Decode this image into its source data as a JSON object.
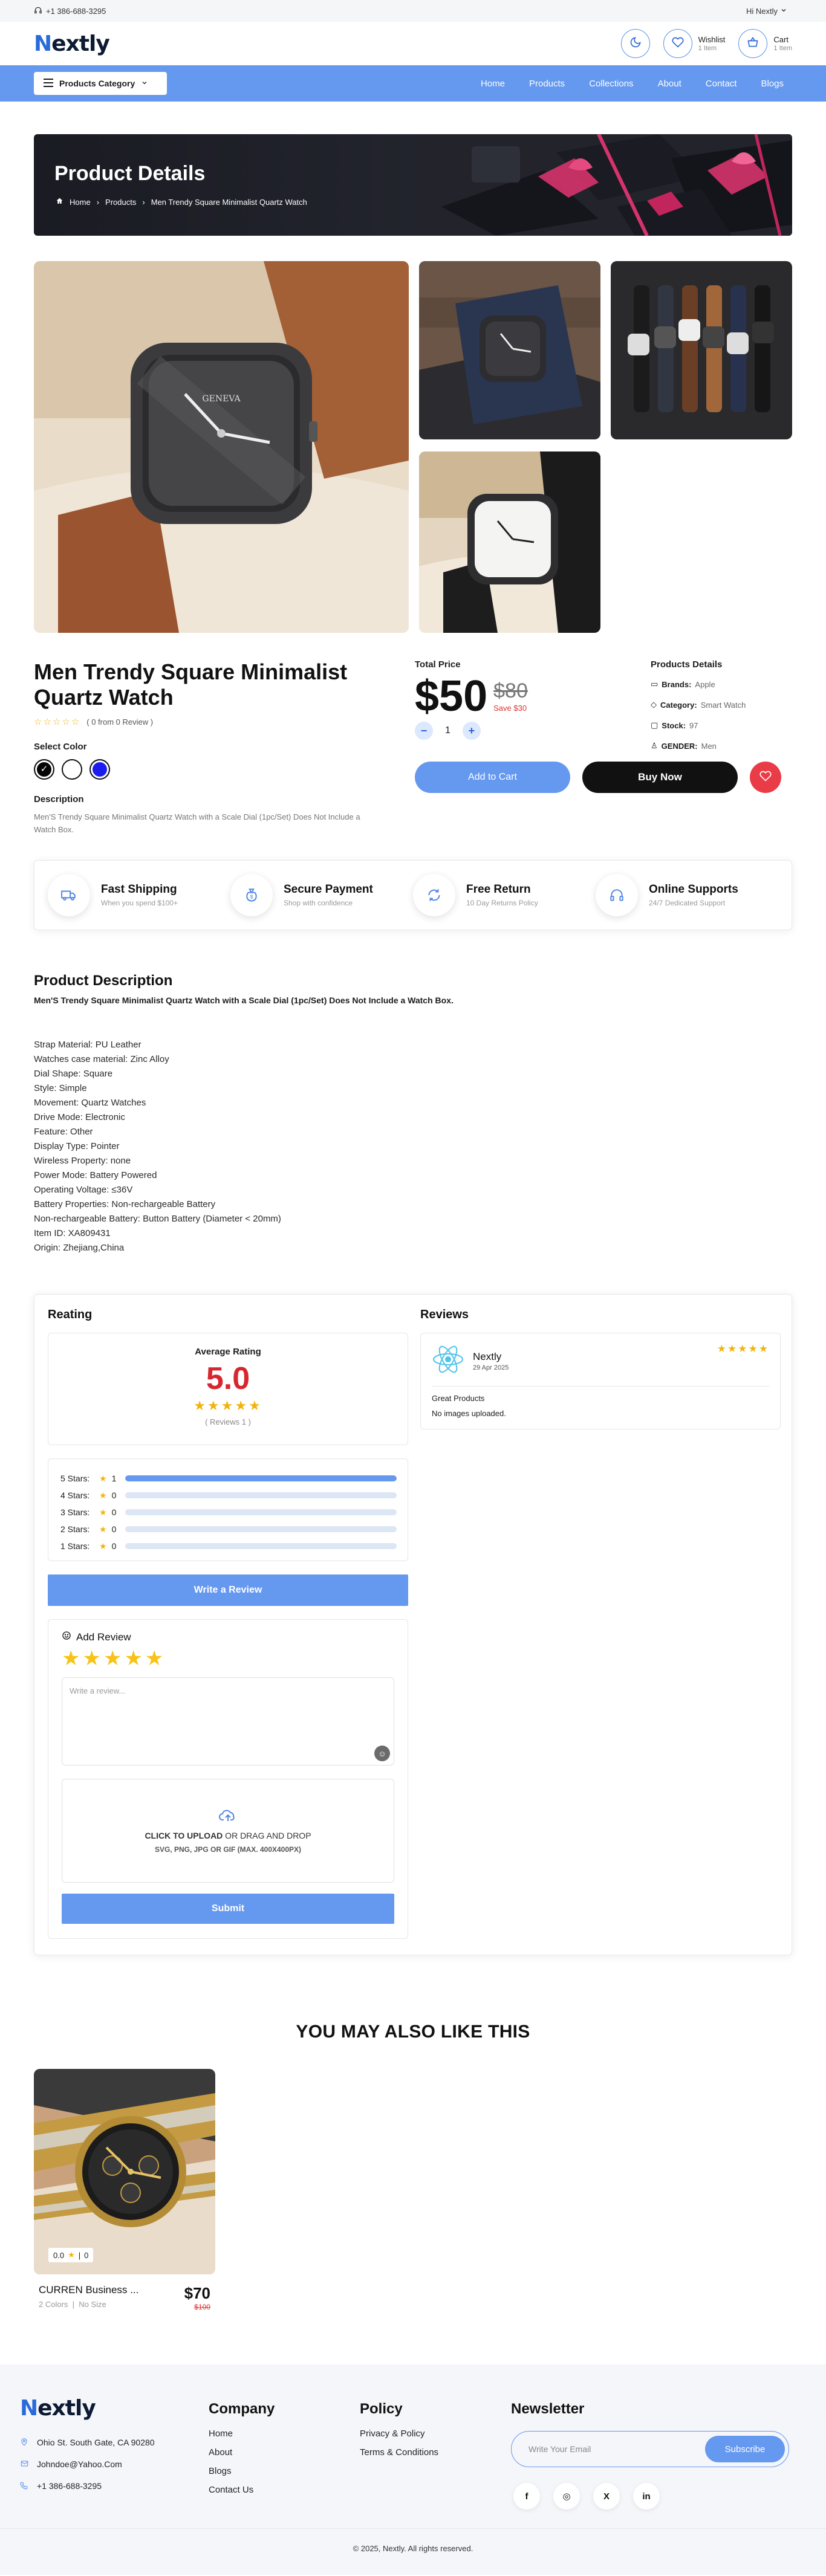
{
  "topbar": {
    "phone": "+1 386-688-3295",
    "greeting": "Hi Nextly"
  },
  "header": {
    "logo_first": "N",
    "logo_rest": "extly",
    "wishlist": {
      "label": "Wishlist",
      "count": "1 Item"
    },
    "cart": {
      "label": "Cart",
      "count": "1 Item"
    }
  },
  "nav": {
    "category_label": "Products Category",
    "links": [
      "Home",
      "Products",
      "Collections",
      "About",
      "Contact",
      "Blogs"
    ]
  },
  "banner": {
    "title": "Product Details",
    "crumbs": [
      "Home",
      "Products",
      "Men Trendy Square Minimalist Quartz Watch"
    ]
  },
  "gallery": {
    "watch_brand": "GENEVA"
  },
  "product": {
    "title": "Men Trendy Square Minimalist Quartz Watch",
    "review_summary": "( 0 from 0 Review )",
    "select_color_label": "Select Color",
    "colors": [
      "#050505",
      "#ffffff",
      "#1c1cf0"
    ],
    "description_label": "Description",
    "description": "Men'S Trendy Square Minimalist Quartz Watch with a Scale Dial (1pc/Set) Does Not Include a Watch Box.",
    "total_price_label": "Total Price",
    "price": "$50",
    "old_price": "$80",
    "save": "Save $30",
    "qty_minus": "−",
    "qty_plus": "+",
    "quantity": "1",
    "add_to_cart": "Add to Cart",
    "buy_now": "Buy Now",
    "details_label": "Products Details",
    "details": [
      {
        "key": "Brands:",
        "value": "Apple"
      },
      {
        "key": "Category:",
        "value": "Smart Watch"
      },
      {
        "key": "Stock:",
        "value": "97"
      },
      {
        "key": "GENDER:",
        "value": "Men"
      }
    ]
  },
  "features": [
    {
      "title": "Fast Shipping",
      "sub": "When you spend $100+"
    },
    {
      "title": "Secure Payment",
      "sub": "Shop with confidence"
    },
    {
      "title": "Free Return",
      "sub": "10 Day Returns Policy"
    },
    {
      "title": "Online Supports",
      "sub": "24/7 Dedicated Support"
    }
  ],
  "description_section": {
    "title": "Product Description",
    "lead": "Men'S Trendy Square Minimalist Quartz Watch with a Scale Dial (1pc/Set) Does Not Include a Watch Box.",
    "specs": [
      "Strap Material: PU Leather",
      "Watches case material: Zinc Alloy",
      "Dial Shape: Square",
      "Style: Simple",
      "Movement: Quartz Watches",
      "Drive Mode: Electronic",
      "Feature: Other",
      "Display Type: Pointer",
      "Wireless Property: none",
      "Power Mode: Battery Powered",
      "Operating Voltage: ≤36V",
      "Battery Properties: Non-rechargeable Battery",
      "Non-rechargeable Battery: Button Battery (Diameter < 20mm)",
      "Item ID: XA809431",
      "Origin: Zhejiang,China"
    ]
  },
  "reviews_section": {
    "rating_title": "Reating",
    "average_label": "Average Rating",
    "average_value": "5.0",
    "stars": "★★★★★",
    "reviews_count": "( Reviews 1 )",
    "distribution": [
      {
        "label": "5 Stars:",
        "count": "1",
        "fraction": 1.0
      },
      {
        "label": "4 Stars:",
        "count": "0",
        "fraction": 0
      },
      {
        "label": "3 Stars:",
        "count": "0",
        "fraction": 0
      },
      {
        "label": "2 Stars:",
        "count": "0",
        "fraction": 0
      },
      {
        "label": "1 Stars:",
        "count": "0",
        "fraction": 0
      }
    ],
    "write_review": "Write a Review",
    "add_review_title": "Add Review",
    "add_stars": "★★★★★",
    "textarea_placeholder": "Write a review...",
    "upload_main_a": "CLICK TO UPLOAD",
    "upload_main_b": " OR DRAG AND DROP",
    "upload_sub": "SVG, PNG, JPG OR GIF (MAX. 400X400PX)",
    "submit": "Submit",
    "reviews_title": "Reviews",
    "review": {
      "name": "Nextly",
      "date": "29 Apr 2025",
      "stars": "★★★★★",
      "text": "Great Products",
      "images_note": "No images uploaded."
    }
  },
  "related": {
    "title": "YOU MAY ALSO LIKE THIS",
    "items": [
      {
        "name": "CURREN Business ...",
        "colors": "2 Colors",
        "size": "No Size",
        "price": "$70",
        "old_price": "$100",
        "rating": "0.0",
        "reviews": "0"
      }
    ]
  },
  "footer": {
    "address": "Ohio St. South Gate, CA 90280",
    "email": "Johndoe@Yahoo.Com",
    "phone": "+1 386-688-3295",
    "company_title": "Company",
    "company_links": [
      "Home",
      "About",
      "Blogs",
      "Contact Us"
    ],
    "policy_title": "Policy",
    "policy_links": [
      "Privacy & Policy",
      "Terms & Conditions"
    ],
    "newsletter_title": "Newsletter",
    "email_placeholder": "Write Your Email",
    "subscribe": "Subscribe",
    "socials": [
      "f",
      "◎",
      "X",
      "in"
    ],
    "copyright": "© 2025, Nextly. All rights reserved."
  }
}
